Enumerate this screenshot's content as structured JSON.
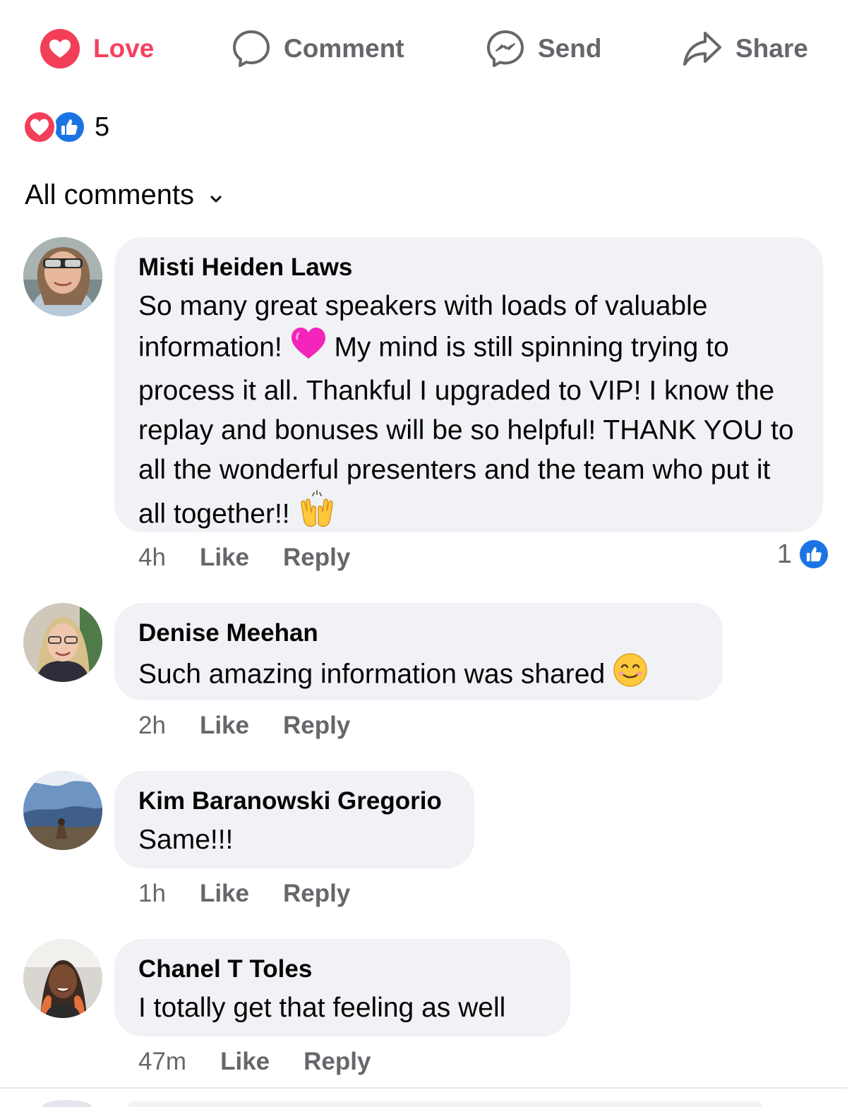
{
  "actions": {
    "love": "Love",
    "comment": "Comment",
    "send": "Send",
    "share": "Share"
  },
  "reactions": {
    "count": "5",
    "types": [
      "heart-icon",
      "like-icon"
    ]
  },
  "filter": {
    "label": "All comments"
  },
  "comments": [
    {
      "author": "Misti Heiden Laws",
      "text_part1": "So many great speakers with loads of valuable information!",
      "text_part2": " My mind is still spinning trying to process it all. Thankful I upgraded to VIP! I know the replay and bonuses will be so helpful! THANK YOU to all the wonderful presenters and the team who put it all together!!",
      "emoji1": "pink-heart-emoji",
      "emoji2": "raising-hands-emoji",
      "time": "4h",
      "like": "Like",
      "reply": "Reply",
      "like_count": "1"
    },
    {
      "author": "Denise Meehan",
      "text": "Such amazing information was shared",
      "emoji": "smiling-face-emoji",
      "time": "2h",
      "like": "Like",
      "reply": "Reply"
    },
    {
      "author": "Kim Baranowski Gregorio",
      "text": "Same!!!",
      "time": "1h",
      "like": "Like",
      "reply": "Reply"
    },
    {
      "author": "Chanel T Toles",
      "text": "I totally get that feeling as well",
      "time": "47m",
      "like": "Like",
      "reply": "Reply"
    }
  ],
  "colors": {
    "love": "#f3425f",
    "like_blue": "#1b74e4",
    "secondary_text": "#65676b",
    "bubble": "#f0f2f5"
  }
}
